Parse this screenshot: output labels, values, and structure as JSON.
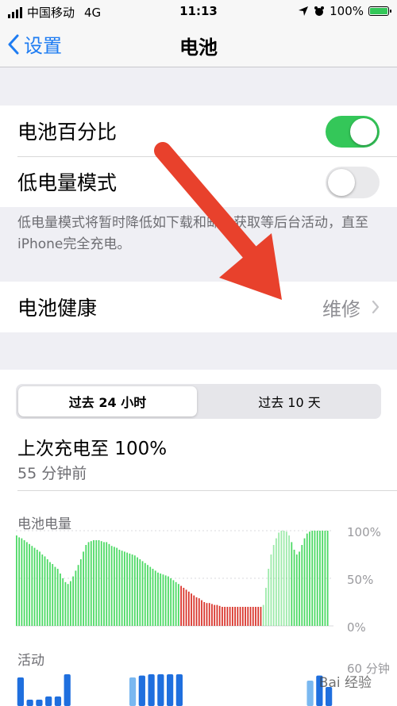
{
  "status_bar": {
    "carrier": "中国移动",
    "network": "4G",
    "time": "11:13",
    "battery": "100%"
  },
  "nav": {
    "back_label": "设置",
    "title": "电池"
  },
  "settings": {
    "battery_percentage_label": "电池百分比",
    "battery_percentage_on": true,
    "low_power_label": "低电量模式",
    "low_power_on": false,
    "low_power_footnote": "低电量模式将暂时降低如下载和邮件获取等后台活动，直至iPhone完全充电。",
    "battery_health_label": "电池健康",
    "battery_health_value": "维修"
  },
  "usage": {
    "segments": [
      "过去 24 小时",
      "过去 10 天"
    ],
    "selected_segment": 0,
    "last_charge_text": "上次充电至 100%",
    "last_charge_ago": "55 分钟前",
    "battery_level_label": "电池电量",
    "activity_label": "活动",
    "y_ticks": [
      "100%",
      "50%",
      "0%"
    ],
    "activity_y_tick": "60 分钟"
  },
  "watermark": "Bai 经验",
  "colors": {
    "accent": "#1e7cf2",
    "toggle_on": "#34c759",
    "battery_bar": "#4cd964",
    "low_bar": "#d9342b",
    "activity_bar": "#1f6fde",
    "activity_light": "#7ab8f0",
    "arrow": "#e8412c"
  },
  "chart_data": [
    {
      "type": "bar",
      "title": "电池电量",
      "ylim": [
        0,
        100
      ],
      "y_ticks": [
        "100%",
        "50%",
        "0%"
      ],
      "values": [
        95,
        93,
        92,
        90,
        88,
        86,
        84,
        82,
        80,
        78,
        75,
        73,
        70,
        67,
        65,
        62,
        60,
        55,
        50,
        46,
        44,
        47,
        52,
        58,
        64,
        70,
        78,
        85,
        88,
        89,
        90,
        90,
        90,
        89,
        88,
        88,
        86,
        84,
        83,
        82,
        80,
        79,
        78,
        77,
        76,
        75,
        74,
        72,
        70,
        68,
        66,
        64,
        62,
        60,
        58,
        56,
        55,
        54,
        53,
        52,
        50,
        48,
        46,
        44,
        42,
        40,
        38,
        36,
        34,
        32,
        30,
        29,
        27,
        25,
        24,
        24,
        23,
        22,
        22,
        21,
        20,
        20,
        20,
        20,
        20,
        20,
        20,
        20,
        20,
        20,
        20,
        20,
        20,
        20,
        20,
        20,
        22,
        40,
        60,
        75,
        85,
        92,
        98,
        100,
        100,
        99,
        95,
        88,
        80,
        75,
        78,
        85,
        92,
        97,
        99,
        100,
        100,
        100,
        100,
        100,
        100,
        100
      ],
      "low_power_range": [
        64,
        95
      ],
      "charging_range": [
        96,
        106
      ]
    },
    {
      "type": "bar",
      "title": "活动",
      "ylim": [
        0,
        60
      ],
      "y_ticks": [
        "60 分钟"
      ],
      "values": [
        45,
        10,
        10,
        15,
        15,
        50,
        0,
        0,
        0,
        0,
        0,
        0,
        45,
        48,
        50,
        50,
        50,
        50,
        0,
        0,
        0,
        0,
        0,
        0,
        0,
        0,
        0,
        0,
        0,
        0,
        0,
        40,
        48,
        30
      ]
    }
  ]
}
